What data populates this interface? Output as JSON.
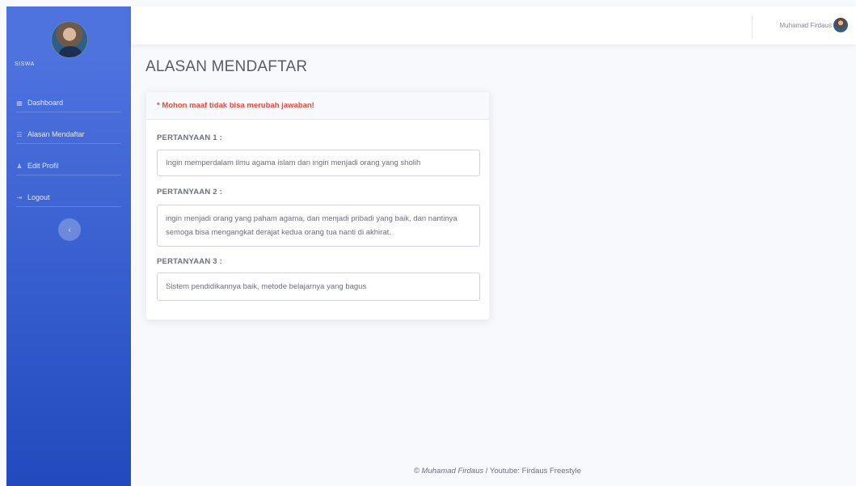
{
  "sidebar": {
    "brand_label": "SISWA",
    "items": [
      {
        "icon": "dashboard-icon",
        "glyph": "▦",
        "label": "Dashboard"
      },
      {
        "icon": "list-icon",
        "glyph": "☰",
        "label": "Alasan Mendaftar"
      },
      {
        "icon": "user-icon",
        "glyph": "♟",
        "label": "Edit Profil"
      },
      {
        "icon": "logout-icon",
        "glyph": "⇥",
        "label": "Logout"
      }
    ],
    "toggle_glyph": "‹"
  },
  "topbar": {
    "user_name": "Muhamad Firdaus"
  },
  "main": {
    "title": "ALASAN MENDAFTAR",
    "card": {
      "warning": "* Mohon maaf tidak bisa merubah jawaban!",
      "questions": [
        {
          "label": "PERTANYAAN 1 :",
          "answer": "Ingin memperdalam ilmu agama islam dan ingin menjadi orang yang sholih"
        },
        {
          "label": "PERTANYAAN 2 :",
          "answer": "ingin menjadi orang yang paham agama, dan menjadi pribadi yang baik, dan nantinya semoga bisa mengangkat derajat kedua orang tua nanti di akhirat."
        },
        {
          "label": "PERTANYAAN 3 :",
          "answer": "Sistem pendidikannya baik, metode belajarnya yang bagus"
        }
      ]
    }
  },
  "footer": {
    "author": "© Muhamad Firdaus",
    "rest": " / Youtube: Firdaus Freestyle"
  },
  "colors": {
    "sidebar_top": "#4e73df",
    "sidebar_bottom": "#224abe",
    "warning": "#e74a3b",
    "background": "#f8f9fc"
  }
}
